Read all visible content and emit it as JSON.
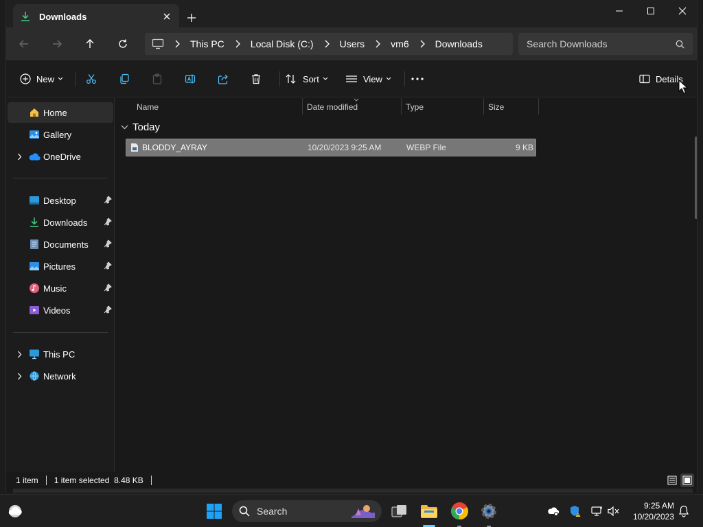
{
  "window": {
    "tab_title": "Downloads",
    "tab_icon": "download-icon"
  },
  "nav": {
    "breadcrumb": [
      "This PC",
      "Local Disk (C:)",
      "Users",
      "vm6",
      "Downloads"
    ],
    "search_placeholder": "Search Downloads"
  },
  "commands": {
    "new_label": "New",
    "sort_label": "Sort",
    "view_label": "View",
    "details_label": "Details"
  },
  "sidebar": {
    "home": "Home",
    "gallery": "Gallery",
    "onedrive": "OneDrive",
    "desktop": "Desktop",
    "downloads": "Downloads",
    "documents": "Documents",
    "pictures": "Pictures",
    "music": "Music",
    "videos": "Videos",
    "this_pc": "This PC",
    "network": "Network"
  },
  "columns": {
    "name": "Name",
    "date_modified": "Date modified",
    "type": "Type",
    "size": "Size"
  },
  "group": {
    "label": "Today"
  },
  "files": [
    {
      "name": "BLODDY_AYRAY",
      "date_modified": "10/20/2023 9:25 AM",
      "type": "WEBP File",
      "size": "9 KB"
    }
  ],
  "status": {
    "item_count": "1 item",
    "selection": "1 item selected  8.48 KB"
  },
  "taskbar": {
    "search_label": "Search",
    "time": "9:25 AM",
    "date": "10/20/2023"
  },
  "colors": {
    "accent": "#60cdff",
    "selected_row": "#777777",
    "window_bg": "#191919"
  }
}
